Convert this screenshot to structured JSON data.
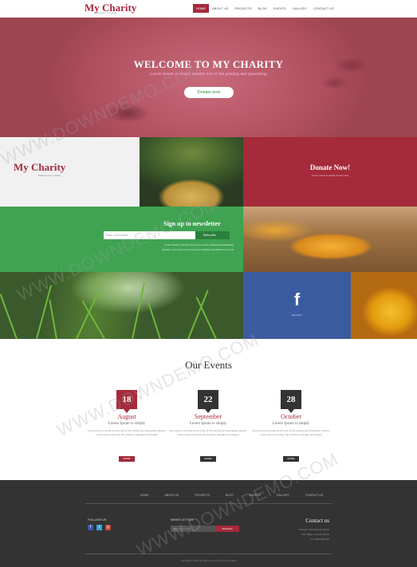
{
  "header": {
    "logo": "My Charity",
    "tagline": "Making every holiday",
    "nav": [
      "HOME",
      "ABOUT US",
      "PROJECTS",
      "BLOG",
      "EVENTS",
      "GALLERY",
      "CONTACT US"
    ]
  },
  "hero": {
    "title": "WELCOME TO MY CHARITY",
    "subtitle": "Lorem Ipsum is simply dummy text of the printing and typesetting",
    "button": "Donate now"
  },
  "tiles": {
    "logo": "My Charity",
    "logo_tag": "Making every holiday",
    "donate_title": "Donate Now!",
    "donate_sub": "Lorem ipsum is simply dummy text",
    "newsletter_title": "Sign up to newsletter",
    "newsletter_placeholder": "Enter your email",
    "newsletter_button": "Subscribe",
    "newsletter_desc1": "Lorem Ipsum is simply dummy text of the printing and typesetting",
    "newsletter_desc2": "industry. Lorem Ipsum has been the industry's standard dummy text",
    "facebook_glyph": "f",
    "facebook_sub": "Like Now !"
  },
  "events": {
    "title": "Our Events",
    "items": [
      {
        "day": "18",
        "month": "August",
        "sub": "Lorem Ipsum is simply",
        "text": "Lorem Ipsum is simply dummy text of the printing and typesetting industry. Lorem Ipsum has been the industry's standard unchanged",
        "button": "MORE"
      },
      {
        "day": "22",
        "month": "September",
        "sub": "Lorem Ipsum is simply",
        "text": "Lorem Ipsum is simply dummy text of the printing and typesetting industry. Lorem Ipsum has been the industry's standard unchanged",
        "button": "MORE"
      },
      {
        "day": "28",
        "month": "October",
        "sub": "Lorem Ipsum is simply",
        "text": "Lorem Ipsum is simply dummy text of the printing and typesetting industry. Lorem Ipsum has been the industry's standard unchanged",
        "button": "MORE"
      }
    ]
  },
  "footer": {
    "nav": [
      "HOME",
      "ABOUT US",
      "PROJECTS",
      "BLOG",
      "EVENTS",
      "GALLERY",
      "CONTACT US"
    ],
    "follow": "FOLLOW US",
    "social": [
      "f",
      "t",
      "g"
    ],
    "newsletter": "NEWS LETTER",
    "newsletter_placeholder": "Enter your email",
    "newsletter_button": "Subscribe",
    "contact_title": "Contact us",
    "address": [
      "Address: Street Name Street",
      "Your State, Country Name",
      "ph: (000) 000-000"
    ],
    "copyright": "Copyright © 2015 all rights reserved | Free Template"
  },
  "watermark": "WWW.DOWNDEMO.COM",
  "colors": {
    "brand": "#a52a3a",
    "green": "#3fa352",
    "facebook": "#3b5ba0",
    "footer": "#333333"
  }
}
